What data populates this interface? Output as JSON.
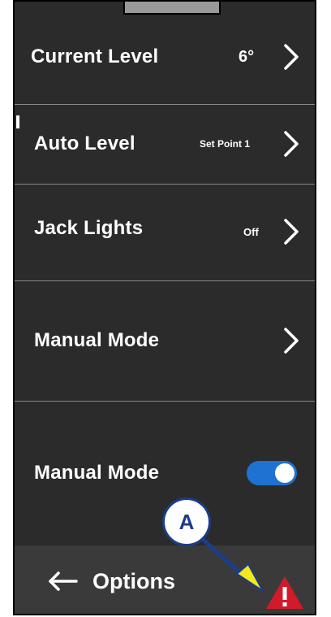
{
  "menu": {
    "items": [
      {
        "label": "Current Level",
        "value": "6°",
        "icon": "chevron-right-icon"
      },
      {
        "label": "Auto Level",
        "value": "Set Point 1",
        "icon": "chevron-right-icon"
      },
      {
        "label": "Jack Lights",
        "value": "Off",
        "icon": "chevron-right-icon"
      },
      {
        "label": "Manual Mode",
        "value": "",
        "icon": "chevron-right-icon"
      }
    ],
    "toggle_row": {
      "label": "Manual Mode",
      "state": "on"
    }
  },
  "bottom_bar": {
    "back_label": "Options",
    "back_icon": "arrow-left-icon",
    "warning_icon": "warning-triangle-icon"
  },
  "callout": {
    "label": "A"
  },
  "colors": {
    "background": "#2b2b2b",
    "text": "#ffffff",
    "toggle_on": "#1e73d2",
    "warning": "#d11b2a",
    "callout": "#1c3d8c",
    "callout_arrowhead": "#f2ea1a"
  }
}
